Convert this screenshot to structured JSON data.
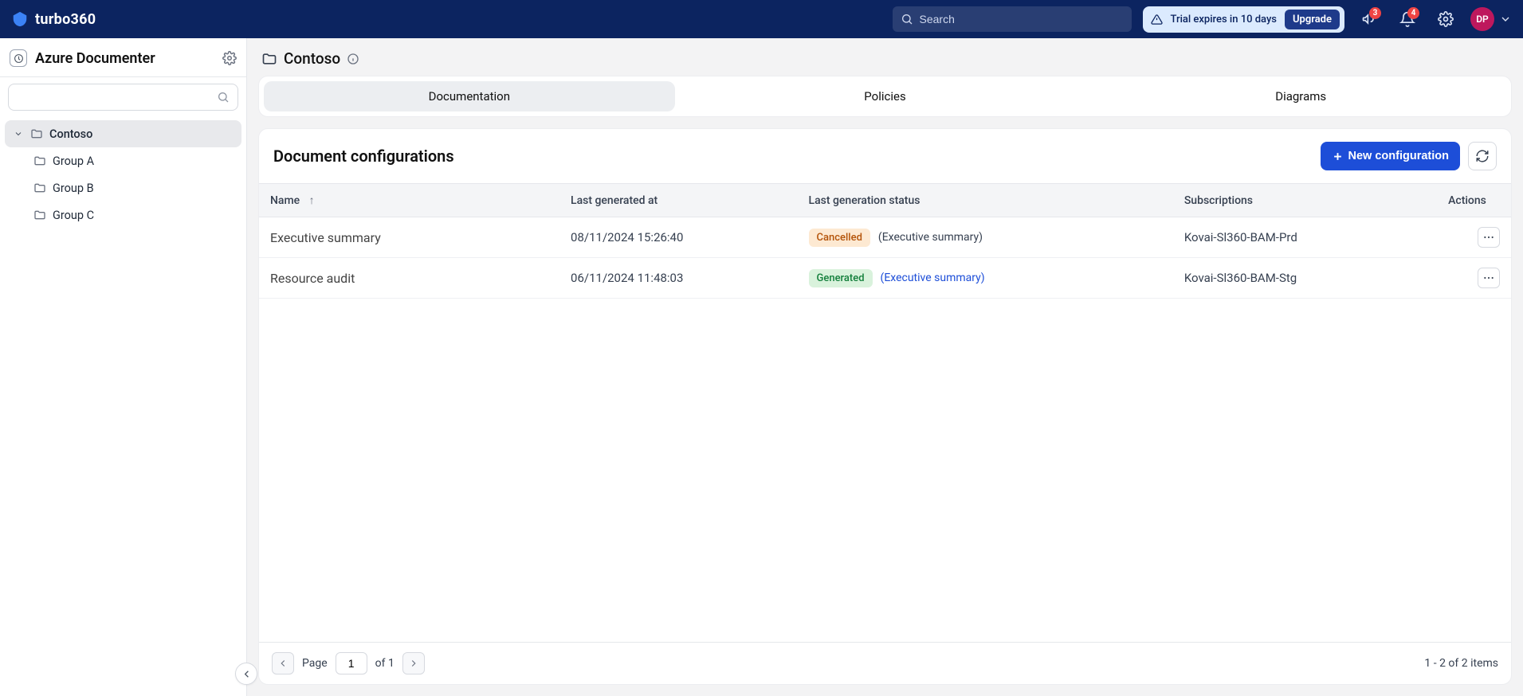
{
  "brand": "turbo360",
  "topbar": {
    "search_placeholder": "Search",
    "trial_text": "Trial expires in 10 days",
    "upgrade_label": "Upgrade",
    "announce_badge": "3",
    "bell_badge": "4",
    "avatar_initials": "DP"
  },
  "sidebar": {
    "module_title": "Azure Documenter",
    "search_placeholder": "",
    "tree": {
      "root": {
        "label": "Contoso",
        "expanded": true
      },
      "children": [
        {
          "label": "Group A"
        },
        {
          "label": "Group B"
        },
        {
          "label": "Group C"
        }
      ]
    }
  },
  "breadcrumb": {
    "folder": "Contoso"
  },
  "tabs": {
    "items": [
      "Documentation",
      "Policies",
      "Diagrams"
    ],
    "active_index": 0
  },
  "panel": {
    "title": "Document configurations",
    "new_btn": "New configuration"
  },
  "table": {
    "columns": {
      "name": "Name",
      "last_gen": "Last generated at",
      "status": "Last generation status",
      "subs": "Subscriptions",
      "actions": "Actions"
    },
    "rows": [
      {
        "name": "Executive summary",
        "last_generated": "08/11/2024 15:26:40",
        "status": {
          "label": "Cancelled",
          "kind": "cancelled",
          "note": "(Executive summary)",
          "note_link": false
        },
        "subscription": "Kovai-Sl360-BAM-Prd"
      },
      {
        "name": "Resource audit",
        "last_generated": "06/11/2024 11:48:03",
        "status": {
          "label": "Generated",
          "kind": "generated",
          "note": "(Executive summary)",
          "note_link": true
        },
        "subscription": "Kovai-Sl360-BAM-Stg"
      }
    ]
  },
  "pager": {
    "page_label": "Page",
    "page_value": "1",
    "of_label": "of 1",
    "range_text": "1 - 2 of 2 items"
  }
}
